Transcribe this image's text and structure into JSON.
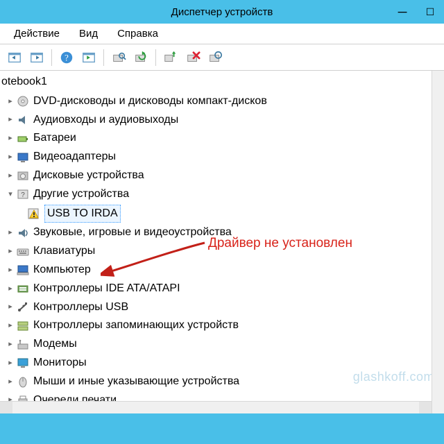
{
  "window": {
    "title": "Диспетчер устройств"
  },
  "menubar": {
    "items": [
      "Действие",
      "Вид",
      "Справка"
    ]
  },
  "toolbar": {
    "icons": [
      "console-back",
      "console-forward",
      "help",
      "show-hidden",
      "scan-hardware",
      "update-driver",
      "uninstall",
      "disable"
    ]
  },
  "tree": {
    "root": "otebook1",
    "nodes": [
      {
        "icon": "disc",
        "label": "DVD-дисководы и дисководы компакт-дисков"
      },
      {
        "icon": "audio",
        "label": "Аудиовходы и аудиовыходы"
      },
      {
        "icon": "battery",
        "label": "Батареи"
      },
      {
        "icon": "display",
        "label": "Видеоадаптеры"
      },
      {
        "icon": "disk",
        "label": "Дисковые устройства"
      },
      {
        "icon": "unknown",
        "label": "Другие устройства",
        "children": [
          {
            "icon": "warning",
            "label": "USB TO IRDA"
          }
        ]
      },
      {
        "icon": "audio2",
        "label": "Звуковые, игровые и видеоустройства"
      },
      {
        "icon": "keyboard",
        "label": "Клавиатуры"
      },
      {
        "icon": "computer",
        "label": "Компьютер"
      },
      {
        "icon": "ide",
        "label": "Контроллеры IDE ATA/ATAPI"
      },
      {
        "icon": "usb",
        "label": "Контроллеры USB"
      },
      {
        "icon": "storage",
        "label": "Контроллеры запоминающих устройств"
      },
      {
        "icon": "modem",
        "label": "Модемы"
      },
      {
        "icon": "monitor",
        "label": "Мониторы"
      },
      {
        "icon": "mouse",
        "label": "Мыши и иные указывающие устройства"
      },
      {
        "icon": "printer",
        "label": "Очереди печати"
      }
    ]
  },
  "annotation": {
    "text": "Драйвер не установлен",
    "color": "#d8231a"
  },
  "watermark": "glashkoff.com"
}
